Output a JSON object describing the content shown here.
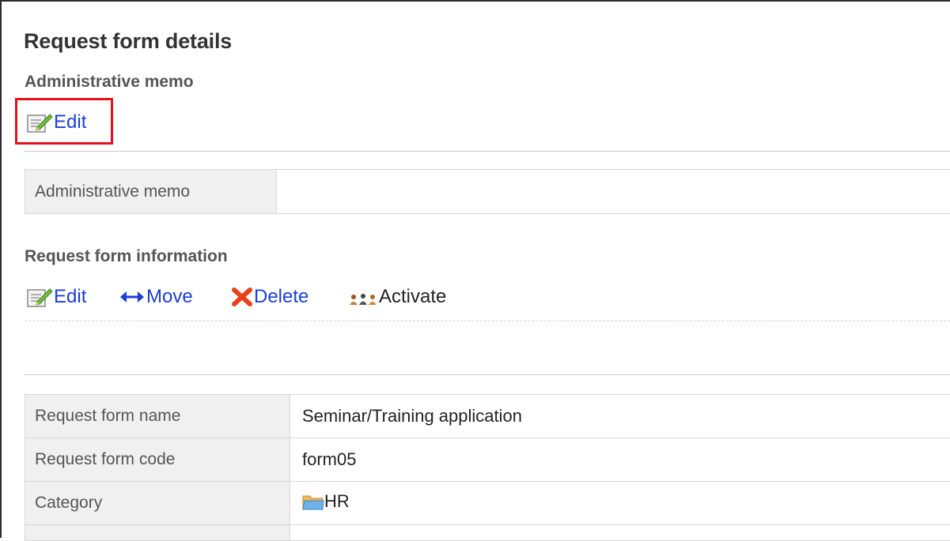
{
  "page": {
    "title": "Request form details"
  },
  "admin_memo": {
    "heading": "Administrative memo",
    "edit_label": "Edit",
    "table": {
      "label": "Administrative memo",
      "value": ""
    }
  },
  "form_info": {
    "heading": "Request form information",
    "actions": [
      {
        "label": "Edit",
        "icon": "edit-icon"
      },
      {
        "label": "Move",
        "icon": "move-arrows-icon"
      },
      {
        "label": "Delete",
        "icon": "delete-x-icon"
      },
      {
        "label": "Activate",
        "icon": "activate-users-icon"
      }
    ],
    "rows": [
      {
        "label": "Request form name",
        "value": "Seminar/Training application"
      },
      {
        "label": "Request form code",
        "value": "form05"
      },
      {
        "label": "Category",
        "value": "HR",
        "icon": "folder-icon"
      }
    ]
  },
  "colors": {
    "link": "#1a3fd6",
    "highlight": "#e5101e",
    "delete_icon": "#e8401c",
    "label_bg": "#f0f0f0"
  }
}
